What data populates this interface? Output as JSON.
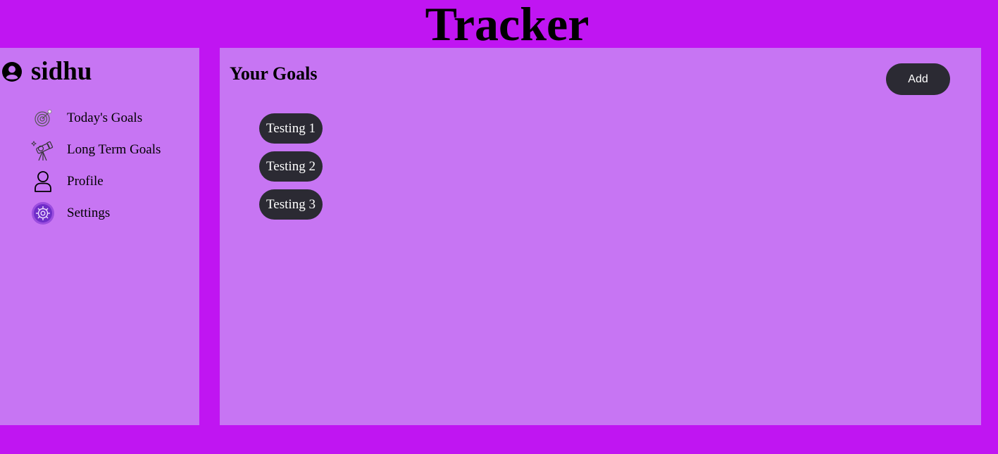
{
  "app": {
    "title": "Tracker",
    "colors": {
      "background": "#c015f2",
      "panel": "#c775f3",
      "button": "#2b2a33",
      "button_text": "#ffffff"
    }
  },
  "sidebar": {
    "username": "sidhu",
    "user_icon": "user-circle-icon",
    "items": [
      {
        "label": "Today's Goals",
        "icon": "target-icon"
      },
      {
        "label": "Long Term Goals",
        "icon": "telescope-icon"
      },
      {
        "label": "Profile",
        "icon": "person-icon"
      },
      {
        "label": "Settings",
        "icon": "gear-icon"
      }
    ]
  },
  "main": {
    "title": "Your Goals",
    "add_label": "Add",
    "goals": [
      {
        "label": "Testing 1"
      },
      {
        "label": "Testing 2"
      },
      {
        "label": "Testing 3"
      }
    ]
  }
}
